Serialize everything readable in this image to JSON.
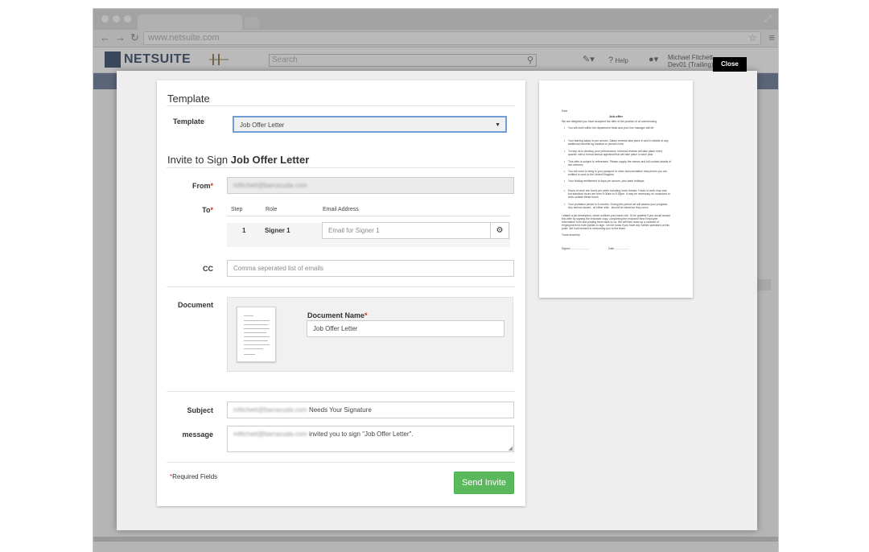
{
  "browser": {
    "url": "www.netsuite.com"
  },
  "app": {
    "logo_text": "NETSUITE",
    "search_placeholder": "Search",
    "help_label": "Help",
    "user_name": "Michael Fitchett",
    "user_role": "Dev01 (Trailing) -",
    "close_label": "Close"
  },
  "template_section": {
    "heading": "Template",
    "label": "Template",
    "selected": "Job Offer Letter"
  },
  "invite_section": {
    "heading_prefix": "Invite to Sign ",
    "heading_doc": "Job Offer Letter",
    "from_label": "From",
    "from_value": "mfitchett@barracuda.com",
    "to_label": "To",
    "col_step": "Step",
    "col_role": "Role",
    "col_email": "Email Address",
    "signer_step": "1",
    "signer_role": "Signer 1",
    "signer_email_placeholder": "Email for Signer 1",
    "cc_label": "CC",
    "cc_placeholder": "Comma seperated list of emails",
    "document_label": "Document",
    "document_name_label": "Document Name",
    "document_name_value": "Job Offer Letter",
    "subject_label": "Subject",
    "subject_sender": "mfitchett@barracuda.com",
    "subject_rest": " Needs Your Signature",
    "message_label": "message",
    "message_sender": "mfitchett@barracuda.com",
    "message_rest": " invited you to sign \"Job Offer Letter\".",
    "required_note": "Required Fields",
    "send_button": "Send Invite"
  },
  "preview": {
    "title": "Job offer",
    "greeting": "Dear",
    "intro": "We are delighted you have accepted the offer of the position of at commencing",
    "items": [
      "You will work within the department head and your line manager will be",
      "Your starting salary is per annum. Salary reviews take place in and in details of any additional benefits eg medical or pension here",
      "To help us to develop your performance, informal reviews will take place every quarter, with a formal annual appraisal that will take place in each year",
      "This offer is subject to references. Please supply the names and full contact details of two referees",
      "You will need to bring in your passport or other documentation that proves you are entitled to work in the United Kingdom",
      "Your holiday entitlement is days per annum, plus bank holidays",
      "Hours of work are hours per week including lunch breaks. Hours of work may vary but standard hours are from 9.00am to 5.30pm. It may be necessary on occasions to work outside these hours",
      "Your probation period is 6 months. During this period we will assess your progress. Any serious issues - at either side - should be raised as they occur"
    ],
    "closing": "I attach a job description, which outlines your basic role. I'd be grateful if you would accept this offer by signing the enclosed copy, completing the enclosed New Employee Information form and posting them back to us. We will then draw up a contract of employment for both parties to sign. Let me know if you have any further questions at this point. We look forward to welcoming you to the team.",
    "signoff": "Yours sincerely",
    "signed": "Signed .........................",
    "date": "Date ..................."
  }
}
